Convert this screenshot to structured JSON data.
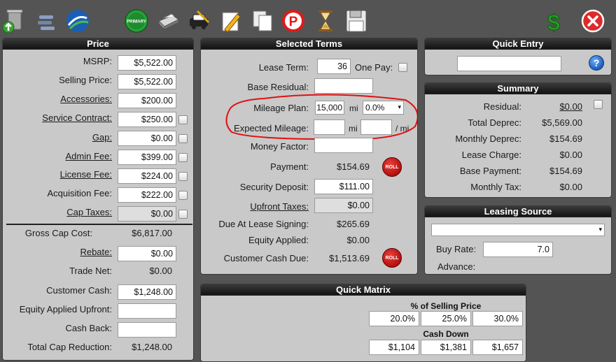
{
  "colors": {
    "accent_red": "#e01010",
    "panel_bg": "#c9c9c9",
    "window_bg": "#545454",
    "header_bg": "#1e1e1e"
  },
  "toolbar": {
    "icons": [
      "upload-trash-icon",
      "list-icon",
      "brand-logo-icon",
      "primary-button-icon",
      "printer-icon",
      "car-document-icon",
      "pencil-note-icon",
      "copy-pages-icon",
      "parking-p-icon",
      "hourglass-icon",
      "save-disk-icon",
      "dollar-icon",
      "close-icon"
    ],
    "primary_label": "PRIMARY",
    "p_label": "P",
    "dollar_label": "$"
  },
  "price": {
    "title": "Price",
    "rows": [
      {
        "label": "MSRP:",
        "value": "$5,522.00"
      },
      {
        "label": "Selling Price:",
        "value": "$5,522.00"
      },
      {
        "label": "Accessories:",
        "value": "$200.00"
      },
      {
        "label": "Service Contract:",
        "value": "$250.00"
      },
      {
        "label": "Gap:",
        "value": "$0.00"
      },
      {
        "label": "Admin Fee:",
        "value": "$399.00"
      },
      {
        "label": "License Fee:",
        "value": "$224.00"
      },
      {
        "label": "Acquisition Fee:",
        "value": "$222.00"
      },
      {
        "label": "Cap Taxes:",
        "value": "$0.00"
      }
    ],
    "gross_cap_cost_label": "Gross Cap Cost:",
    "gross_cap_cost_value": "$6,817.00",
    "rebate_label": "Rebate:",
    "rebate_value": "$0.00",
    "trade_net_label": "Trade Net:",
    "trade_net_value": "$0.00",
    "customer_cash_label": "Customer Cash:",
    "customer_cash_value": "$1,248.00",
    "equity_applied_upfront_label": "Equity Applied Upfront:",
    "equity_applied_upfront_value": "",
    "cash_back_label": "Cash Back:",
    "cash_back_value": "",
    "total_cap_reduction_label": "Total Cap Reduction:",
    "total_cap_reduction_value": "$1,248.00"
  },
  "terms": {
    "title": "Selected Terms",
    "lease_term_label": "Lease Term:",
    "lease_term_value": "36",
    "one_pay_label": "One Pay:",
    "base_residual_label": "Base Residual:",
    "base_residual_value": "",
    "mileage_plan_label": "Mileage Plan:",
    "mileage_plan_value": "15,000",
    "mileage_unit": "mi",
    "mileage_rate_value": "0.0%",
    "expected_mileage_label": "Expected Mileage:",
    "expected_mileage_value": "",
    "expected_mileage_unit": "mi",
    "expected_mileage_per_value": "",
    "per_mi_label": "/ mi",
    "money_factor_label": "Money Factor:",
    "money_factor_value": "",
    "payment_label": "Payment:",
    "payment_value": "$154.69",
    "roll_label": "ROLL",
    "security_deposit_label": "Security Deposit:",
    "security_deposit_value": "$111.00",
    "upfront_taxes_label": "Upfront Taxes:",
    "upfront_taxes_value": "$0.00",
    "due_at_signing_label": "Due At Lease Signing:",
    "due_at_signing_value": "$265.69",
    "equity_applied_label": "Equity Applied:",
    "equity_applied_value": "$0.00",
    "customer_cash_due_label": "Customer Cash Due:",
    "customer_cash_due_value": "$1,513.69"
  },
  "quick_entry": {
    "title": "Quick Entry",
    "value": "",
    "help_label": "?"
  },
  "summary": {
    "title": "Summary",
    "residual_label": "Residual:",
    "residual_value": "$0.00",
    "total_deprec_label": "Total Deprec:",
    "total_deprec_value": "$5,569.00",
    "monthly_deprec_label": "Monthly Deprec:",
    "monthly_deprec_value": "$154.69",
    "lease_charge_label": "Lease Charge:",
    "lease_charge_value": "$0.00",
    "base_payment_label": "Base Payment:",
    "base_payment_value": "$154.69",
    "monthly_tax_label": "Monthly Tax:",
    "monthly_tax_value": "$0.00"
  },
  "leasing_source": {
    "title": "Leasing Source",
    "selected": "",
    "buy_rate_label": "Buy Rate:",
    "buy_rate_value": "7.0",
    "advance_label": "Advance:"
  },
  "quick_matrix": {
    "title": "Quick Matrix",
    "pct_header": "% of Selling Price",
    "percentages": [
      "20.0%",
      "25.0%",
      "30.0%"
    ],
    "cash_down_header": "Cash Down",
    "cash_down": [
      "$1,104",
      "$1,381",
      "$1,657"
    ]
  }
}
